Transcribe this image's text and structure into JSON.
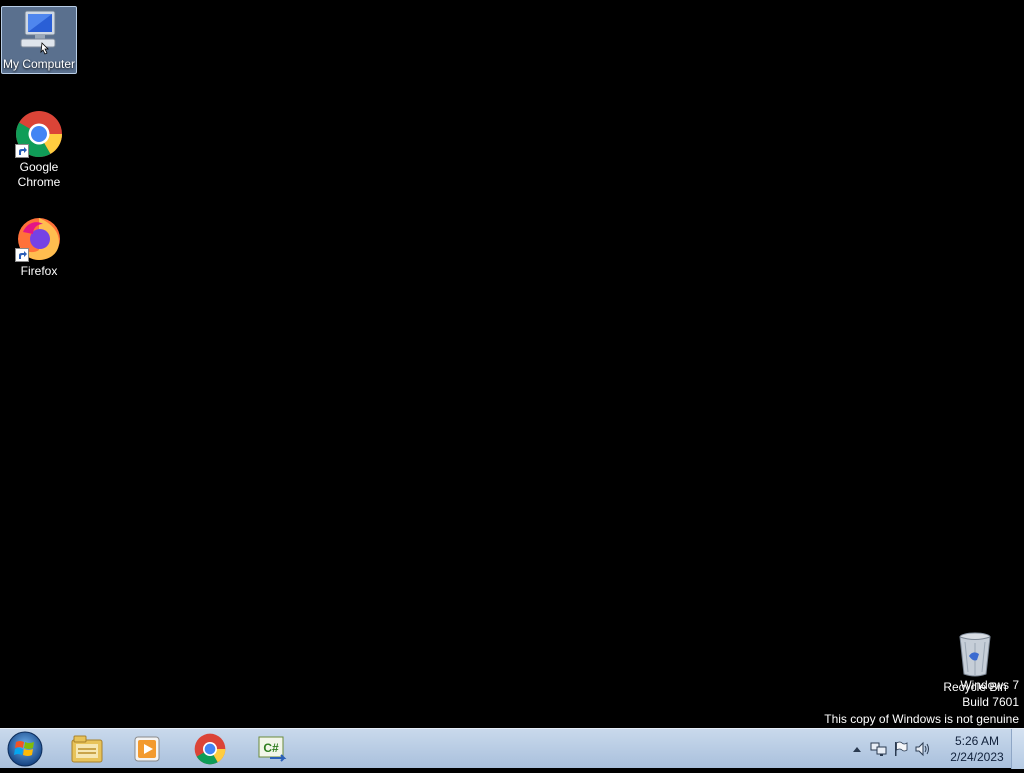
{
  "desktop": {
    "icons": [
      {
        "label": "My Computer",
        "icon": "my-computer-icon",
        "selected": true
      },
      {
        "label": "Google Chrome",
        "icon": "chrome-icon"
      },
      {
        "label": "Firefox",
        "icon": "firefox-icon"
      },
      {
        "label": "Recycle Bin",
        "icon": "recycle-bin-icon"
      }
    ]
  },
  "watermark": {
    "line1": "Windows 7",
    "line2": "Build 7601",
    "line3": "This copy of Windows is not genuine"
  },
  "taskbar": {
    "start_icon": "windows-start-orb",
    "pinned": [
      {
        "icon": "file-explorer-icon"
      },
      {
        "icon": "media-player-icon"
      },
      {
        "icon": "chrome-icon"
      },
      {
        "icon": "csharp-project-icon"
      }
    ],
    "tray": {
      "icons": [
        "show-hidden-icons-arrow",
        "network-icon",
        "action-center-flag-icon",
        "volume-icon"
      ],
      "time": "5:26 AM",
      "date": "2/24/2023"
    }
  },
  "colors": {
    "desktop_bg": "#000000",
    "taskbar_top": "#c9d9ec",
    "taskbar_bottom": "#a9c0dc",
    "selection": "#7896be"
  }
}
